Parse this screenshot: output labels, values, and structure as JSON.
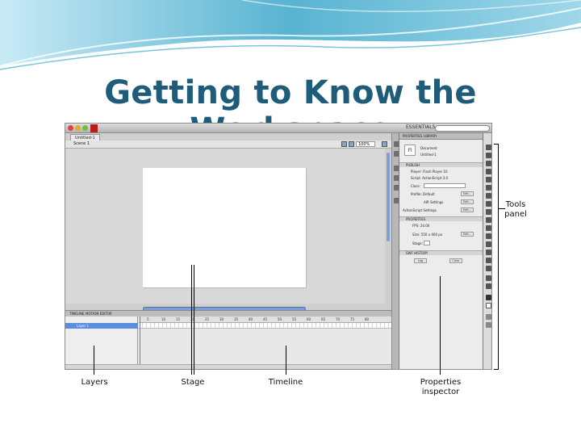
{
  "slide": {
    "title": "Getting to Know the Workspace"
  },
  "app": {
    "window_tab": "Untitled-1",
    "scene": "Scene 1",
    "zoom": "100%",
    "workspace": "ESSENTIALS",
    "panel_tabs": [
      "TIMELINE",
      "MOTION EDITOR"
    ],
    "layer_name": "Layer 1",
    "frame_numbers": [
      "5",
      "10",
      "15",
      "20",
      "25",
      "30",
      "35",
      "40",
      "45",
      "50",
      "55",
      "60",
      "65",
      "70",
      "75",
      "80"
    ],
    "properties": {
      "tabs": [
        "PROPERTIES",
        "LIBRARY"
      ],
      "doc_icon": "Fl",
      "doc_type": "Document",
      "doc_name": "Untitled-1",
      "publish_section": "PUBLISH",
      "player": "Player: Flash Player 10",
      "script": "Script: ActionScript 3.0",
      "class_label": "Class:",
      "profile": "Profile: Default",
      "air_settings": "AIR Settings",
      "as_settings": "ActionScript Settings",
      "edit_label": "Edit...",
      "properties_section": "PROPERTIES",
      "fps": "FPS: 24.00",
      "size": "Size: 550 x 400 px",
      "stage": "Stage:",
      "swf_section": "SWF HISTORY",
      "log_label": "Log",
      "clear_label": "Clear"
    }
  },
  "callouts": {
    "tools_panel": "Tools panel",
    "layers": "Layers",
    "stage": "Stage",
    "timeline": "Timeline",
    "properties_inspector": "Properties inspector"
  },
  "colors": {
    "title": "#1f5c7a",
    "wave_dark": "#3aa6c9",
    "wave_light": "#a9dcee",
    "layer_selected": "#5c8ee0"
  }
}
